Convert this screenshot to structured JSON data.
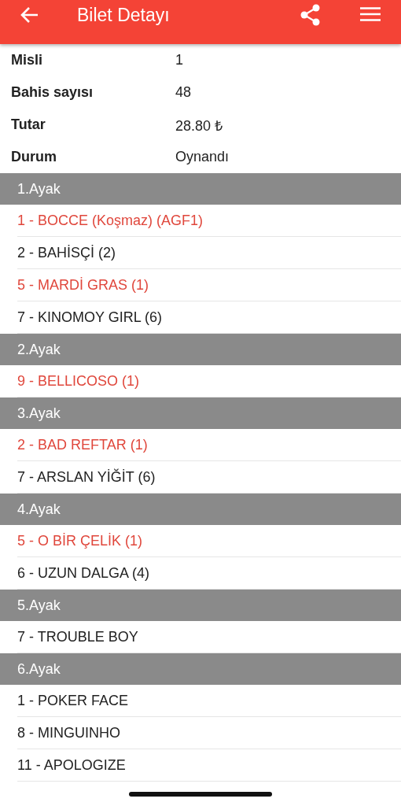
{
  "header": {
    "title": "Bilet Detayı"
  },
  "info": [
    {
      "label": "Misli",
      "value": "1"
    },
    {
      "label": "Bahis sayısı",
      "value": "48"
    },
    {
      "label": "Tutar",
      "value": "28.80 ₺"
    },
    {
      "label": "Durum",
      "value": "Oynandı"
    }
  ],
  "legs": [
    {
      "title": "1.Ayak",
      "horses": [
        {
          "name": "1 - BOCCE (Koşmaz) (AGF1)",
          "won": true
        },
        {
          "name": "2 - BAHİSÇİ (2)",
          "won": false
        },
        {
          "name": "5 - MARDİ GRAS (1)",
          "won": true
        },
        {
          "name": "7 - KINOMOY GIRL (6)",
          "won": false
        }
      ]
    },
    {
      "title": "2.Ayak",
      "horses": [
        {
          "name": "9 - BELLICOSO (1)",
          "won": true
        }
      ]
    },
    {
      "title": "3.Ayak",
      "horses": [
        {
          "name": "2 - BAD REFTAR (1)",
          "won": true
        },
        {
          "name": "7 - ARSLAN YİĞİT (6)",
          "won": false
        }
      ]
    },
    {
      "title": "4.Ayak",
      "horses": [
        {
          "name": "5 - O BİR ÇELİK (1)",
          "won": true
        },
        {
          "name": "6 - UZUN DALGA (4)",
          "won": false
        }
      ]
    },
    {
      "title": "5.Ayak",
      "horses": [
        {
          "name": "7 - TROUBLE BOY",
          "won": false
        }
      ]
    },
    {
      "title": "6.Ayak",
      "horses": [
        {
          "name": "1 - POKER FACE",
          "won": false
        },
        {
          "name": "8 - MINGUINHO",
          "won": false
        },
        {
          "name": "11 - APOLOGIZE",
          "won": false
        }
      ]
    }
  ]
}
